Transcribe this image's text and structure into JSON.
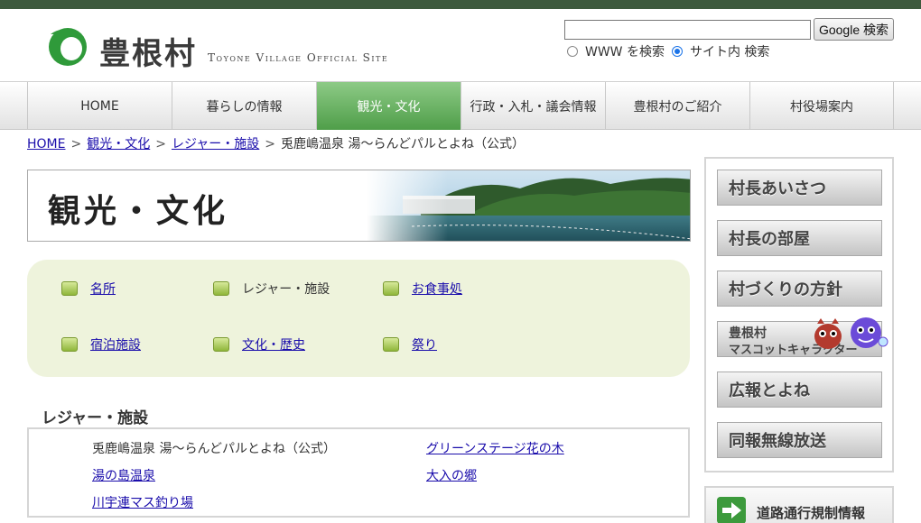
{
  "header": {
    "logo_title": "豊根村",
    "logo_subtitle": "Toyone Village Official Site"
  },
  "search": {
    "value": "",
    "button_label": "Google 検索",
    "option_www": "WWW を検索",
    "option_site": "サイト内 検索",
    "selected": "site"
  },
  "nav": {
    "items": [
      {
        "label": "HOME"
      },
      {
        "label": "暮らしの情報"
      },
      {
        "label": "観光・文化",
        "active": true
      },
      {
        "label": "行政・入札・議会情報"
      },
      {
        "label": "豊根村のご紹介"
      },
      {
        "label": "村役場案内"
      }
    ]
  },
  "breadcrumb": {
    "home": "HOME",
    "level1": "観光・文化",
    "level2": "レジャー・施設",
    "current": "兎鹿嶋温泉 湯〜らんどパルとよね（公式）",
    "separator": ">"
  },
  "banner": {
    "title": "観光・文化"
  },
  "subnav": {
    "items": [
      {
        "label": "名所",
        "link": true
      },
      {
        "label": "レジャー・施設",
        "link": false
      },
      {
        "label": "お食事処",
        "link": true
      },
      {
        "label": "宿泊施設",
        "link": true
      },
      {
        "label": "文化・歴史",
        "link": true
      },
      {
        "label": "祭り",
        "link": true
      }
    ]
  },
  "section": {
    "title": "レジャー・施設",
    "items": [
      {
        "label": "兎鹿嶋温泉 湯〜らんどパルとよね（公式）",
        "link": false
      },
      {
        "label": "グリーンステージ花の木",
        "link": true
      },
      {
        "label": "湯の島温泉",
        "link": true
      },
      {
        "label": "大入の郷",
        "link": true
      },
      {
        "label": "川宇連マス釣り場",
        "link": true
      }
    ]
  },
  "sidebar": {
    "buttons": [
      {
        "label": "村長あいさつ"
      },
      {
        "label": "村長の部屋"
      },
      {
        "label": "村づくりの方針"
      },
      {
        "label": "広報とよね"
      },
      {
        "label": "同報無線放送"
      }
    ],
    "mascot_line1": "豊根村",
    "mascot_line2": "マスコットキャラクター",
    "traffic_label": "道路通行規制情報"
  },
  "colors": {
    "topbar": "#3e5a3e",
    "nav_active": "#5ea858",
    "subnav_bg": "#eef3dc",
    "link": "#1a0dab",
    "logo_green": "#2f9a3a"
  }
}
